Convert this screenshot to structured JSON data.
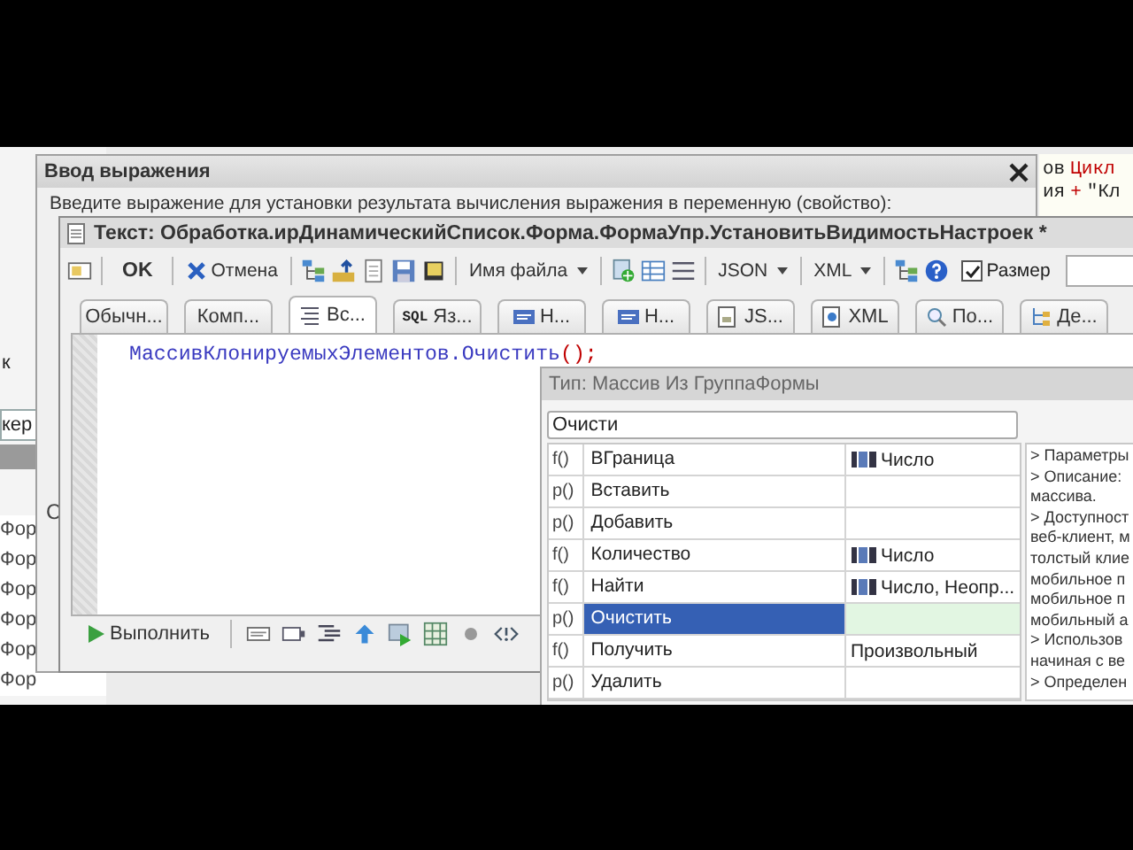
{
  "back_window": {
    "label": "к",
    "field": "кер",
    "list": [
      "Фор",
      "Фор",
      "Фор",
      "Фор",
      "Фор",
      "Фор"
    ]
  },
  "back_code": {
    "lines": [
      [
        {
          "text": "ов",
          "kind": "plain"
        },
        {
          "text": "Цикл",
          "kind": "keyword"
        }
      ],
      [
        {
          "text": "ия",
          "kind": "plain"
        },
        {
          "text": "+",
          "kind": "keyword"
        },
        {
          "text": "\"Кл",
          "kind": "plain"
        }
      ]
    ]
  },
  "dialog": {
    "title": "Ввод выражения",
    "prompt": "Введите выражение для установки результата вычисления выражения в переменную (свойство):",
    "label_fragment": "С"
  },
  "editor_window": {
    "title": "Текст: Обработка.ирДинамическийСписок.Форма.ФормаУпр.УстановитьВидимостьНастроек *",
    "toolbar": {
      "ok": "OK",
      "cancel": "Отмена",
      "file_name": "Имя файла",
      "json": "JSON",
      "xml": "XML",
      "size_checkbox": {
        "label": "Размер",
        "checked": true
      }
    },
    "tabs": [
      {
        "label": "Обычн...",
        "selected": false
      },
      {
        "label": "Комп...",
        "selected": false
      },
      {
        "label": "Вс...",
        "selected": true
      },
      {
        "label": "Яз...",
        "badge": "SQL",
        "selected": false
      },
      {
        "label": "Н...",
        "selected": false
      },
      {
        "label": "Н...",
        "selected": false
      },
      {
        "label": "JS...",
        "selected": false
      },
      {
        "label": "XML",
        "selected": false
      },
      {
        "label": "По...",
        "selected": false
      },
      {
        "label": "Де...",
        "selected": false
      }
    ],
    "code": [
      {
        "text": "МассивКлонируемыхЭлементов.Очистить",
        "kind": "ident"
      },
      {
        "text": "();",
        "kind": "operator"
      }
    ],
    "run_label": "Выполнить"
  },
  "popup": {
    "title": "Тип: Массив Из ГруппаФормы",
    "filter": "Очисти",
    "rows": [
      {
        "marker": "f()",
        "name": "ВГраница",
        "type": "Число",
        "numeric": true,
        "selected": false
      },
      {
        "marker": "p()",
        "name": "Вставить",
        "selected": false
      },
      {
        "marker": "p()",
        "name": "Добавить",
        "selected": false
      },
      {
        "marker": "f()",
        "name": "Количество",
        "type": "Число",
        "numeric": true,
        "selected": false
      },
      {
        "marker": "f()",
        "name": "Найти",
        "type": "Число, Неопр...",
        "numeric": true,
        "selected": false
      },
      {
        "marker": "p()",
        "name": "Очистить",
        "selected": true
      },
      {
        "marker": "f()",
        "name": "Получить",
        "type": "Произвольный",
        "numeric": false,
        "selected": false
      },
      {
        "marker": "p()",
        "name": "Удалить",
        "selected": false
      }
    ],
    "description": [
      "> Параметры",
      "> Описание:",
      "массива.",
      "> Доступност",
      "веб-клиент, м",
      "толстый клие",
      "мобильное п",
      "мобильное п",
      "мобильный а",
      "> Использов",
      "начиная с ве",
      "> Определен"
    ]
  }
}
